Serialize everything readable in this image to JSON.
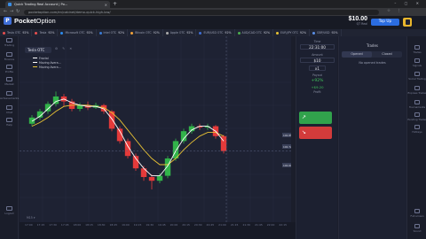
{
  "browser": {
    "tab_title": "Quick Trading Real Account | Po...",
    "url": "pocketoption.com/en/cabinet/demo-quick-high-low/",
    "new_tab": "+",
    "window_controls": "–  ▢  ✕"
  },
  "header": {
    "logo_bold": "Pocket",
    "logo_regular": "Option",
    "balance": "$10.00",
    "balance_label": "QT Real",
    "topup_label": "Top Up"
  },
  "assets": [
    {
      "name": "Tesla OTC",
      "pct": "92%"
    },
    {
      "name": "Tesla",
      "pct": "92%"
    },
    {
      "name": "Microsoft OTC",
      "pct": "92%"
    },
    {
      "name": "Intel OTC",
      "pct": "92%"
    },
    {
      "name": "Bitcoin OTC",
      "pct": "92%"
    },
    {
      "name": "Apple OTC",
      "pct": "92%"
    },
    {
      "name": "EUR/USD OTC",
      "pct": "92%"
    },
    {
      "name": "AUD/CAD OTC",
      "pct": "92%"
    },
    {
      "name": "EUR/JPY OTC",
      "pct": "92%"
    },
    {
      "name": "GBP/USD",
      "pct": "92%"
    }
  ],
  "left_nav": [
    {
      "label": "Trading",
      "icon": "chart-icon"
    },
    {
      "label": "Finance",
      "icon": "wallet-icon"
    },
    {
      "label": "Profile",
      "icon": "user-icon"
    },
    {
      "label": "Market",
      "icon": "cart-icon"
    },
    {
      "label": "Achievements",
      "icon": "trophy-icon"
    },
    {
      "label": "Chat",
      "icon": "chat-icon"
    },
    {
      "label": "Help",
      "icon": "help-icon"
    }
  ],
  "chart": {
    "symbol": "Tesla OTC",
    "indicators": [
      {
        "name": "Fractal",
        "color": "#ffffff"
      },
      {
        "name": "Moving Avera...",
        "color": "#ffffff"
      },
      {
        "name": "Moving Avera...",
        "color": "#e8c234"
      }
    ],
    "toolbar": "⚙ ✎ ✕",
    "timeframe": "M15 ▾",
    "x_ticks": [
      "17:00",
      "17:15",
      "17:30",
      "17:45",
      "18:00",
      "18:15",
      "18:30",
      "18:45",
      "19:00",
      "19:15",
      "19:30",
      "19:45",
      "20:00",
      "20:15",
      "20:30",
      "20:45",
      "21:00",
      "21:15",
      "21:30",
      "21:45",
      "22:00",
      "22:15"
    ],
    "price_labels": [
      "102.85",
      "102.72",
      "102.60"
    ]
  },
  "chart_data": {
    "type": "candlestick",
    "candles": [
      {
        "o": 0.58,
        "c": 0.63,
        "h": 0.65,
        "l": 0.56
      },
      {
        "o": 0.63,
        "c": 0.68,
        "h": 0.7,
        "l": 0.61
      },
      {
        "o": 0.68,
        "c": 0.74,
        "h": 0.76,
        "l": 0.66
      },
      {
        "o": 0.74,
        "c": 0.8,
        "h": 0.84,
        "l": 0.72
      },
      {
        "o": 0.8,
        "c": 0.76,
        "h": 0.82,
        "l": 0.72
      },
      {
        "o": 0.76,
        "c": 0.7,
        "h": 0.78,
        "l": 0.68
      },
      {
        "o": 0.7,
        "c": 0.73,
        "h": 0.75,
        "l": 0.68
      },
      {
        "o": 0.73,
        "c": 0.71,
        "h": 0.76,
        "l": 0.69
      },
      {
        "o": 0.71,
        "c": 0.73,
        "h": 0.75,
        "l": 0.7
      },
      {
        "o": 0.73,
        "c": 0.68,
        "h": 0.74,
        "l": 0.66
      },
      {
        "o": 0.68,
        "c": 0.54,
        "h": 0.69,
        "l": 0.52
      },
      {
        "o": 0.54,
        "c": 0.44,
        "h": 0.56,
        "l": 0.42
      },
      {
        "o": 0.44,
        "c": 0.32,
        "h": 0.46,
        "l": 0.3
      },
      {
        "o": 0.32,
        "c": 0.22,
        "h": 0.34,
        "l": 0.2
      },
      {
        "o": 0.22,
        "c": 0.15,
        "h": 0.24,
        "l": 0.12
      },
      {
        "o": 0.15,
        "c": 0.12,
        "h": 0.17,
        "l": 0.05
      },
      {
        "o": 0.12,
        "c": 0.16,
        "h": 0.18,
        "l": 0.1
      },
      {
        "o": 0.16,
        "c": 0.3,
        "h": 0.32,
        "l": 0.14
      },
      {
        "o": 0.3,
        "c": 0.44,
        "h": 0.46,
        "l": 0.28
      },
      {
        "o": 0.44,
        "c": 0.52,
        "h": 0.54,
        "l": 0.42
      },
      {
        "o": 0.52,
        "c": 0.56,
        "h": 0.58,
        "l": 0.5
      },
      {
        "o": 0.56,
        "c": 0.55,
        "h": 0.58,
        "l": 0.53
      },
      {
        "o": 0.55,
        "c": 0.56,
        "h": 0.58,
        "l": 0.53
      },
      {
        "o": 0.56,
        "c": 0.48,
        "h": 0.57,
        "l": 0.46
      },
      {
        "o": 0.48,
        "c": 0.36,
        "h": 0.49,
        "l": 0.34
      }
    ],
    "ma_fast": [
      0.6,
      0.64,
      0.7,
      0.76,
      0.78,
      0.75,
      0.73,
      0.72,
      0.72,
      0.7,
      0.62,
      0.52,
      0.4,
      0.3,
      0.22,
      0.16,
      0.16,
      0.24,
      0.36,
      0.46,
      0.53,
      0.56,
      0.56,
      0.52,
      0.44
    ],
    "ma_slow": [
      0.56,
      0.59,
      0.63,
      0.68,
      0.72,
      0.73,
      0.73,
      0.73,
      0.72,
      0.71,
      0.67,
      0.61,
      0.53,
      0.45,
      0.37,
      0.3,
      0.25,
      0.25,
      0.3,
      0.37,
      0.43,
      0.48,
      0.51,
      0.51,
      0.48
    ],
    "up_color": "#32b34a",
    "down_color": "#e53a3a",
    "ma_fast_color": "#ffffff",
    "ma_slow_color": "#e8c234"
  },
  "trade_panel": {
    "time_label": "Time",
    "time_value": "22:31:00",
    "amount_label": "Amount",
    "amount_value": "$10",
    "multiplier": "x1",
    "payout_label": "Payout",
    "payout_pct": "+92%",
    "payout_value": "+$9.20",
    "profit_label": "Profit"
  },
  "trades": {
    "title": "Trades",
    "tab_opened": "Opened",
    "tab_closed": "Closed",
    "empty": "No opened trades"
  },
  "right_nav": [
    {
      "label": "Trades",
      "icon": "list-icon"
    },
    {
      "label": "Signals",
      "icon": "bell-icon"
    },
    {
      "label": "Social Trading",
      "icon": "users-icon"
    },
    {
      "label": "Express Trades",
      "icon": "bolt-icon"
    },
    {
      "label": "Tournaments",
      "icon": "cup-icon"
    },
    {
      "label": "Pending Trades",
      "icon": "clock-icon"
    },
    {
      "label": "Hotkeys",
      "icon": "keyboard-icon"
    }
  ],
  "bottom_right_nav": [
    {
      "label": "Full screen",
      "icon": "expand-icon"
    },
    {
      "label": "Sound",
      "icon": "speaker-icon"
    }
  ],
  "bottom_left_nav": {
    "label": "Logout",
    "icon": "logout-icon"
  }
}
